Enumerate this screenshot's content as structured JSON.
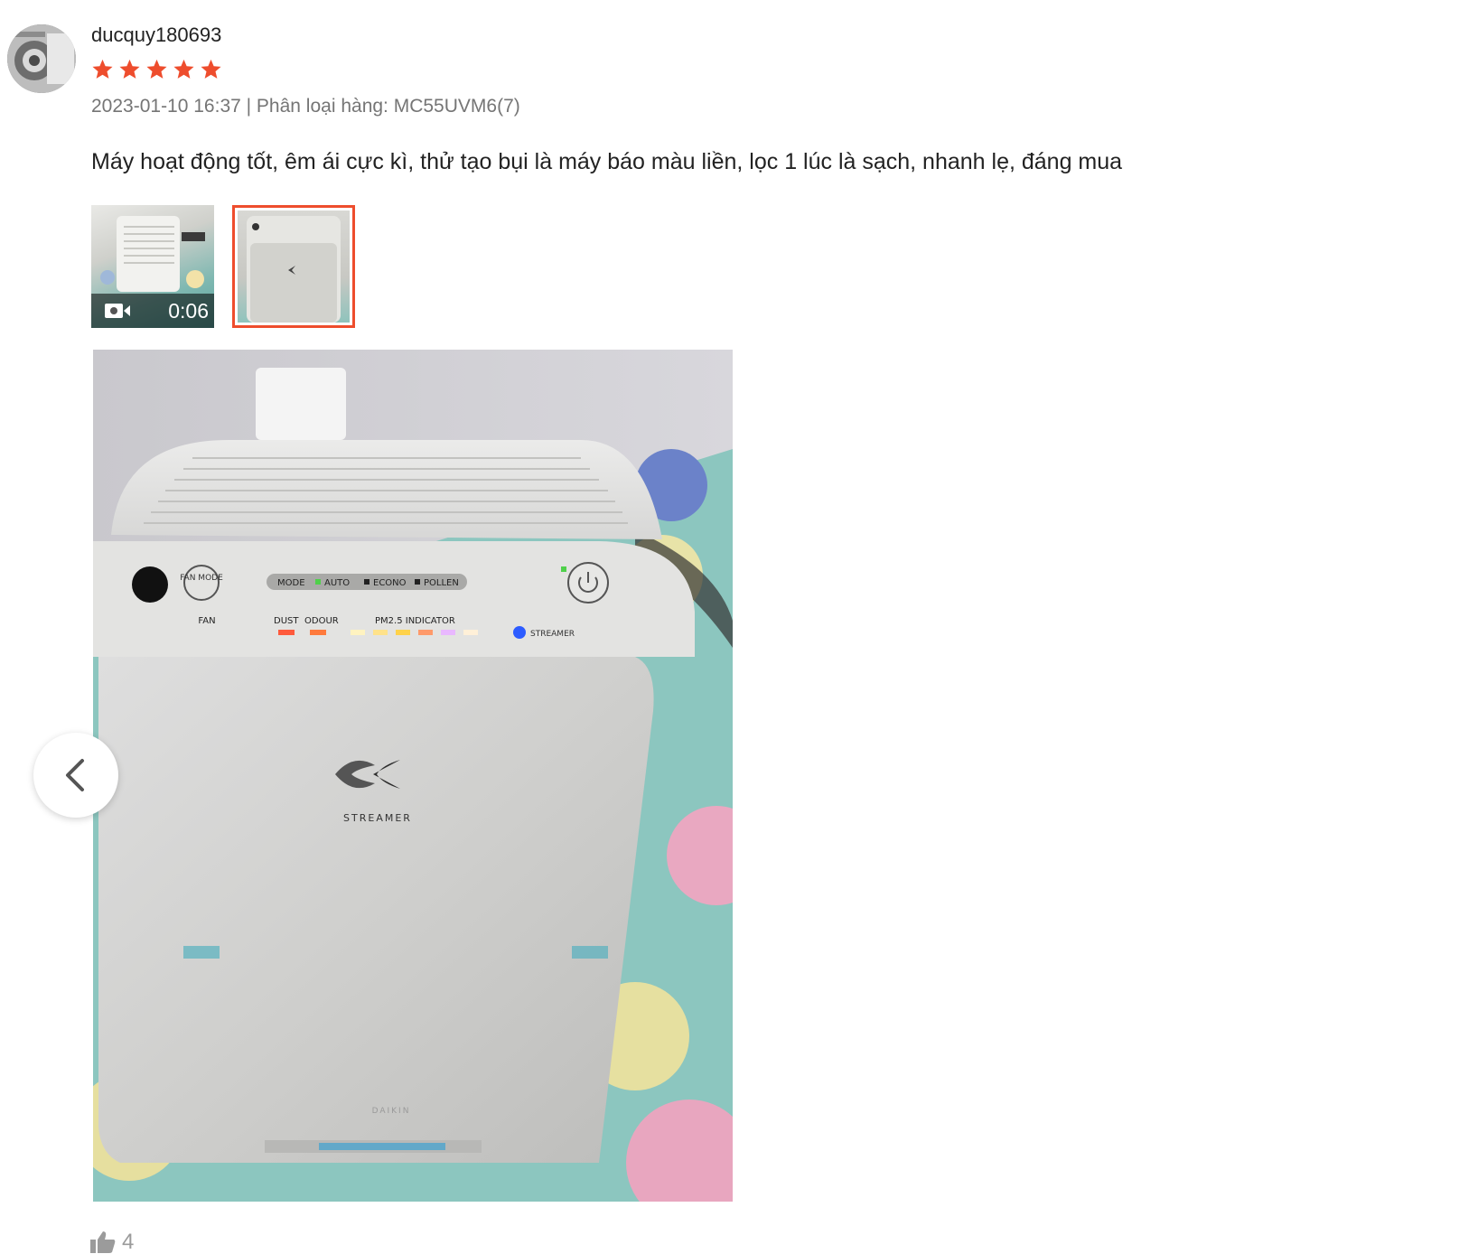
{
  "review": {
    "username": "ducquy180693",
    "rating": 5,
    "rating_max": 5,
    "meta": "2023-01-10 16:37 | Phân loại hàng: MC55UVM6(7)",
    "comment": "Máy hoạt động tốt, êm ái cực kì, thử tạo bụi là máy báo màu liền, lọc 1 lúc là sạch, nhanh lẹ, đáng mua",
    "media": {
      "video": {
        "duration": "0:06",
        "icon": "video-camera-icon"
      },
      "selected_photo_index": 1
    },
    "like": {
      "icon": "thumbs-up-icon",
      "count": "4"
    }
  },
  "viewer": {
    "prev_icon": "chevron-left-icon"
  },
  "photo_labels": {
    "mode": "MODE",
    "auto": "AUTO",
    "econo": "ECONO",
    "pollen": "POLLEN",
    "fan_mode": "FAN MODE",
    "fan": "FAN",
    "dust": "DUST",
    "odour": "ODOUR",
    "pm25": "PM2.5 INDICATOR",
    "streamer": "STREAMER",
    "brand": "DAIKIN"
  },
  "colors": {
    "accent": "#ee4d2d",
    "star": "#ee4d2d",
    "meta_text": "#757575",
    "like_gray": "#9b9b9b"
  }
}
